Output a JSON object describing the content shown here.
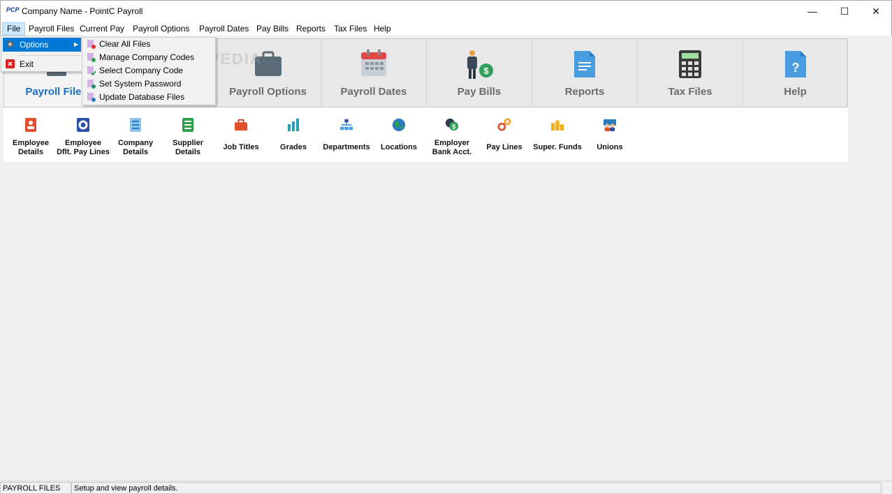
{
  "window": {
    "logo": "PCP",
    "title": "Company Name - PointC Payroll",
    "minimize": "—",
    "maximize": "☐",
    "close": "✕"
  },
  "menubar": [
    "File",
    "Payroll Files",
    "Current Pay",
    "Payroll Options",
    "Payroll Dates",
    "Pay Bills",
    "Reports",
    "Tax Files",
    "Help"
  ],
  "file_menu": {
    "options": "Options",
    "exit": "Exit"
  },
  "options_submenu": [
    "Clear All Files",
    "Manage Company Codes",
    "Select Company Code",
    "Set System Password",
    "Update Database Files"
  ],
  "ribbon": {
    "payroll_files": "Payroll Files",
    "payroll_options": "Payroll Options",
    "payroll_dates": "Payroll Dates",
    "pay_bills": "Pay Bills",
    "reports": "Reports",
    "tax_files": "Tax Files",
    "help": "Help"
  },
  "subbar": {
    "employee_details": "Employee\nDetails",
    "employee_dflt": "Employee\nDflt. Pay Lines",
    "company_details": "Company\nDetails",
    "supplier_details": "Supplier\nDetails",
    "job_titles": "Job Titles",
    "grades": "Grades",
    "departments": "Departments",
    "locations": "Locations",
    "employer_bank": "Employer\nBank Acct.",
    "pay_lines": "Pay Lines",
    "super_funds": "Super. Funds",
    "unions": "Unions"
  },
  "watermark": "SOFTPEDIA",
  "status": {
    "section": "PAYROLL FILES",
    "message": "Setup and view payroll details."
  },
  "colors": {
    "selected_tab": "#1a6fc4",
    "highlight": "#0078d7"
  }
}
